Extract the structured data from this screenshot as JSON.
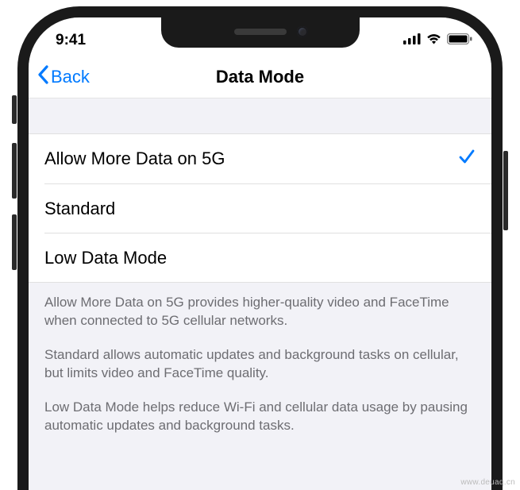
{
  "status_bar": {
    "time": "9:41"
  },
  "nav": {
    "back_label": "Back",
    "title": "Data Mode"
  },
  "options": [
    {
      "label": "Allow More Data on 5G",
      "selected": true
    },
    {
      "label": "Standard",
      "selected": false
    },
    {
      "label": "Low Data Mode",
      "selected": false
    }
  ],
  "footer": {
    "p1": "Allow More Data on 5G provides higher-quality video and FaceTime when connected to 5G cellular networks.",
    "p2": "Standard allows automatic updates and background tasks on cellular, but limits video and FaceTime quality.",
    "p3": "Low Data Mode helps reduce Wi-Fi and cellular data usage by pausing automatic updates and background tasks."
  },
  "watermark": "www.deuaq.cn"
}
